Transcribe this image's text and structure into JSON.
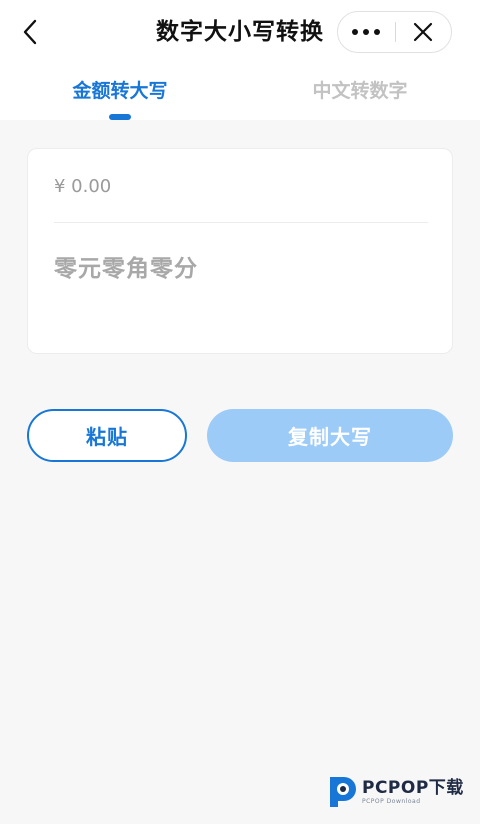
{
  "header": {
    "title": "数字大小写转换",
    "back_icon": "chevron-left-icon",
    "more_icon": "more-dots-icon",
    "close_icon": "close-icon"
  },
  "tabs": [
    {
      "label": "金额转大写",
      "active": true
    },
    {
      "label": "中文转数字",
      "active": false
    }
  ],
  "converter": {
    "amount_placeholder": "¥ 0.00",
    "amount_value": "",
    "result_text": "零元零角零分"
  },
  "actions": {
    "paste_label": "粘贴",
    "copy_label": "复制大写"
  },
  "watermark": {
    "main": "PCPOP下载",
    "sub": "PCPOP Download"
  },
  "colors": {
    "accent": "#1877d6",
    "copy_button_bg": "#9ccbf7",
    "inactive_tab": "#c2c2c2",
    "page_bg": "#f7f7f7"
  }
}
